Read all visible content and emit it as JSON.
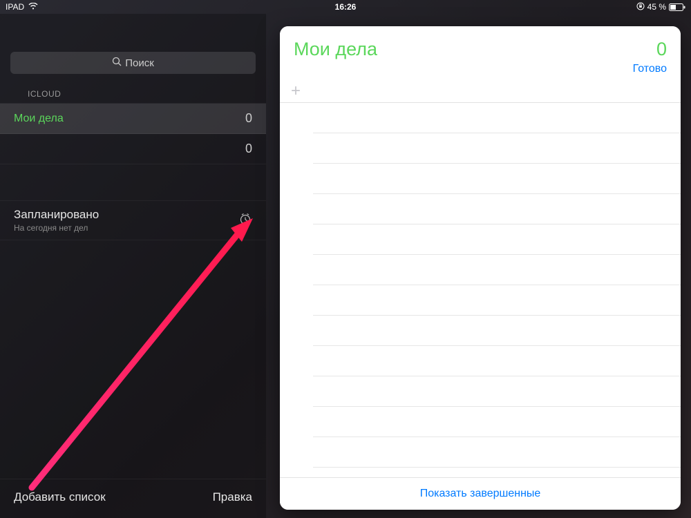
{
  "status_bar": {
    "device": "IPAD",
    "time": "16:26",
    "battery_text": "45 %"
  },
  "sidebar": {
    "search_placeholder": "Поиск",
    "section_label": "ICLOUD",
    "lists": [
      {
        "label": "Мои дела",
        "count": "0",
        "selected": true
      },
      {
        "label": "",
        "count": "0",
        "selected": false
      }
    ],
    "scheduled": {
      "title": "Запланировано",
      "subtitle": "На сегодня нет дел"
    },
    "footer": {
      "add_list": "Добавить список",
      "edit": "Правка"
    }
  },
  "detail": {
    "title": "Мои дела",
    "count": "0",
    "done_label": "Готово",
    "show_completed": "Показать завершенные"
  }
}
